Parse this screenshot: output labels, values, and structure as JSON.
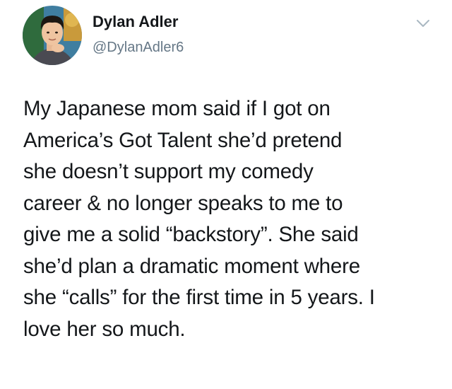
{
  "tweet": {
    "author": {
      "display_name": "Dylan Adler",
      "handle": "@DylanAdler6",
      "avatar_icon": "profile-photo"
    },
    "menu_icon": "chevron-down-icon",
    "text_lines": [
      "My Japanese mom said if I got on",
      "America’s Got Talent she’d pretend",
      "she doesn’t support my comedy",
      "career & no longer speaks to me to",
      "give me a solid “backstory”. She said",
      "she’d plan a dramatic moment where",
      "she “calls” for the first time in 5 years. I",
      "love her so much."
    ]
  },
  "colors": {
    "text_primary": "#14171a",
    "text_secondary": "#657786",
    "chevron": "#aab8c2",
    "background": "#ffffff"
  }
}
